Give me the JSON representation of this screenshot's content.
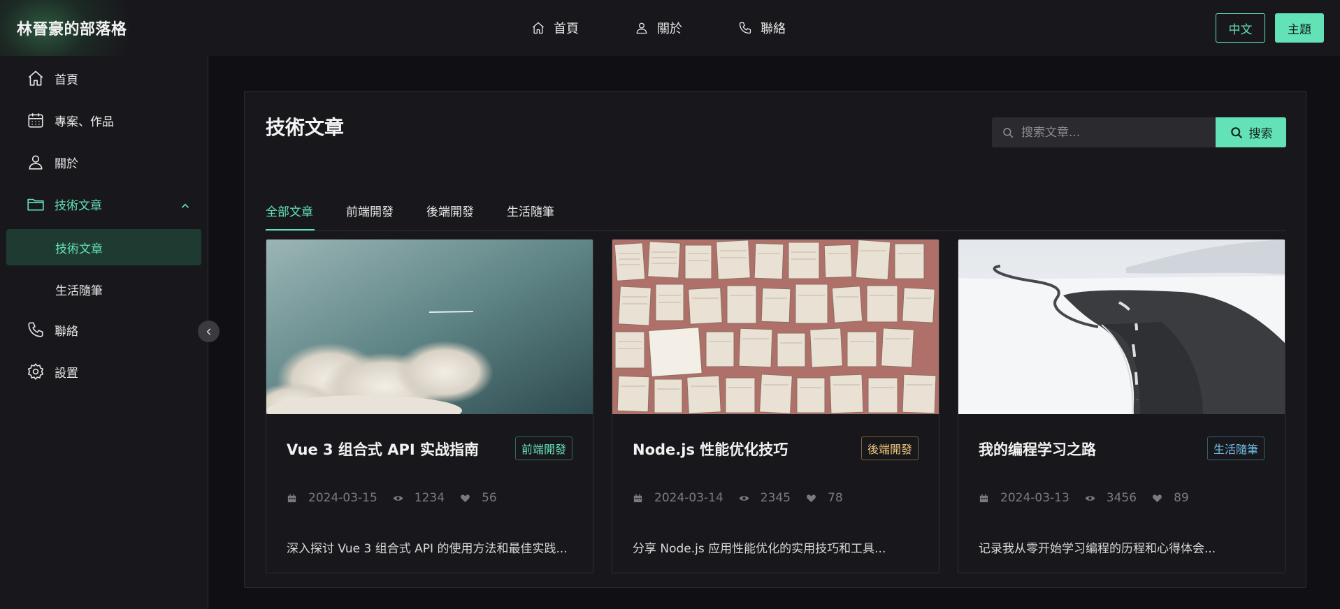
{
  "header": {
    "brand": "林晉豪的部落格",
    "nav": [
      {
        "label": "首頁",
        "icon": "home-icon"
      },
      {
        "label": "關於",
        "icon": "user-icon"
      },
      {
        "label": "聯絡",
        "icon": "phone-icon"
      }
    ],
    "lang_button": "中文",
    "theme_button": "主題"
  },
  "sidebar": {
    "items": [
      {
        "label": "首頁",
        "icon": "home-icon"
      },
      {
        "label": "專案、作品",
        "icon": "calendar-icon"
      },
      {
        "label": "關於",
        "icon": "user-icon"
      },
      {
        "label": "技術文章",
        "icon": "folder-icon",
        "expanded": true,
        "active": true
      },
      {
        "label": "聯絡",
        "icon": "phone-icon"
      },
      {
        "label": "設置",
        "icon": "gear-icon"
      }
    ],
    "subitems": [
      {
        "label": "技術文章",
        "active": true
      },
      {
        "label": "生活隨筆",
        "active": false
      }
    ]
  },
  "main": {
    "title": "技術文章",
    "search": {
      "placeholder": "搜索文章...",
      "button": "搜索"
    },
    "tabs": [
      {
        "label": "全部文章",
        "active": true
      },
      {
        "label": "前端開發",
        "active": false
      },
      {
        "label": "後端開發",
        "active": false
      },
      {
        "label": "生活隨筆",
        "active": false
      }
    ],
    "articles": [
      {
        "title": "Vue 3 组合式 API 实战指南",
        "tag": "前端開發",
        "date": "2024-03-15",
        "views": "1234",
        "likes": "56",
        "excerpt": "深入探讨 Vue 3 组合式 API 的使用方法和最佳实践..."
      },
      {
        "title": "Node.js 性能优化技巧",
        "tag": "後端開發",
        "date": "2024-03-14",
        "views": "2345",
        "likes": "78",
        "excerpt": "分享 Node.js 应用性能优化的实用技巧和工具..."
      },
      {
        "title": "我的编程学习之路",
        "tag": "生活隨筆",
        "date": "2024-03-13",
        "views": "3456",
        "likes": "89",
        "excerpt": "记录我从零开始学习编程的历程和心得体会..."
      }
    ]
  },
  "colors": {
    "accent": "#63e2b7",
    "tag_frontend": "#63e2b7",
    "tag_backend": "#f2c97d",
    "tag_life": "#70c0e8",
    "background": "#101014",
    "surface": "#18181c"
  }
}
